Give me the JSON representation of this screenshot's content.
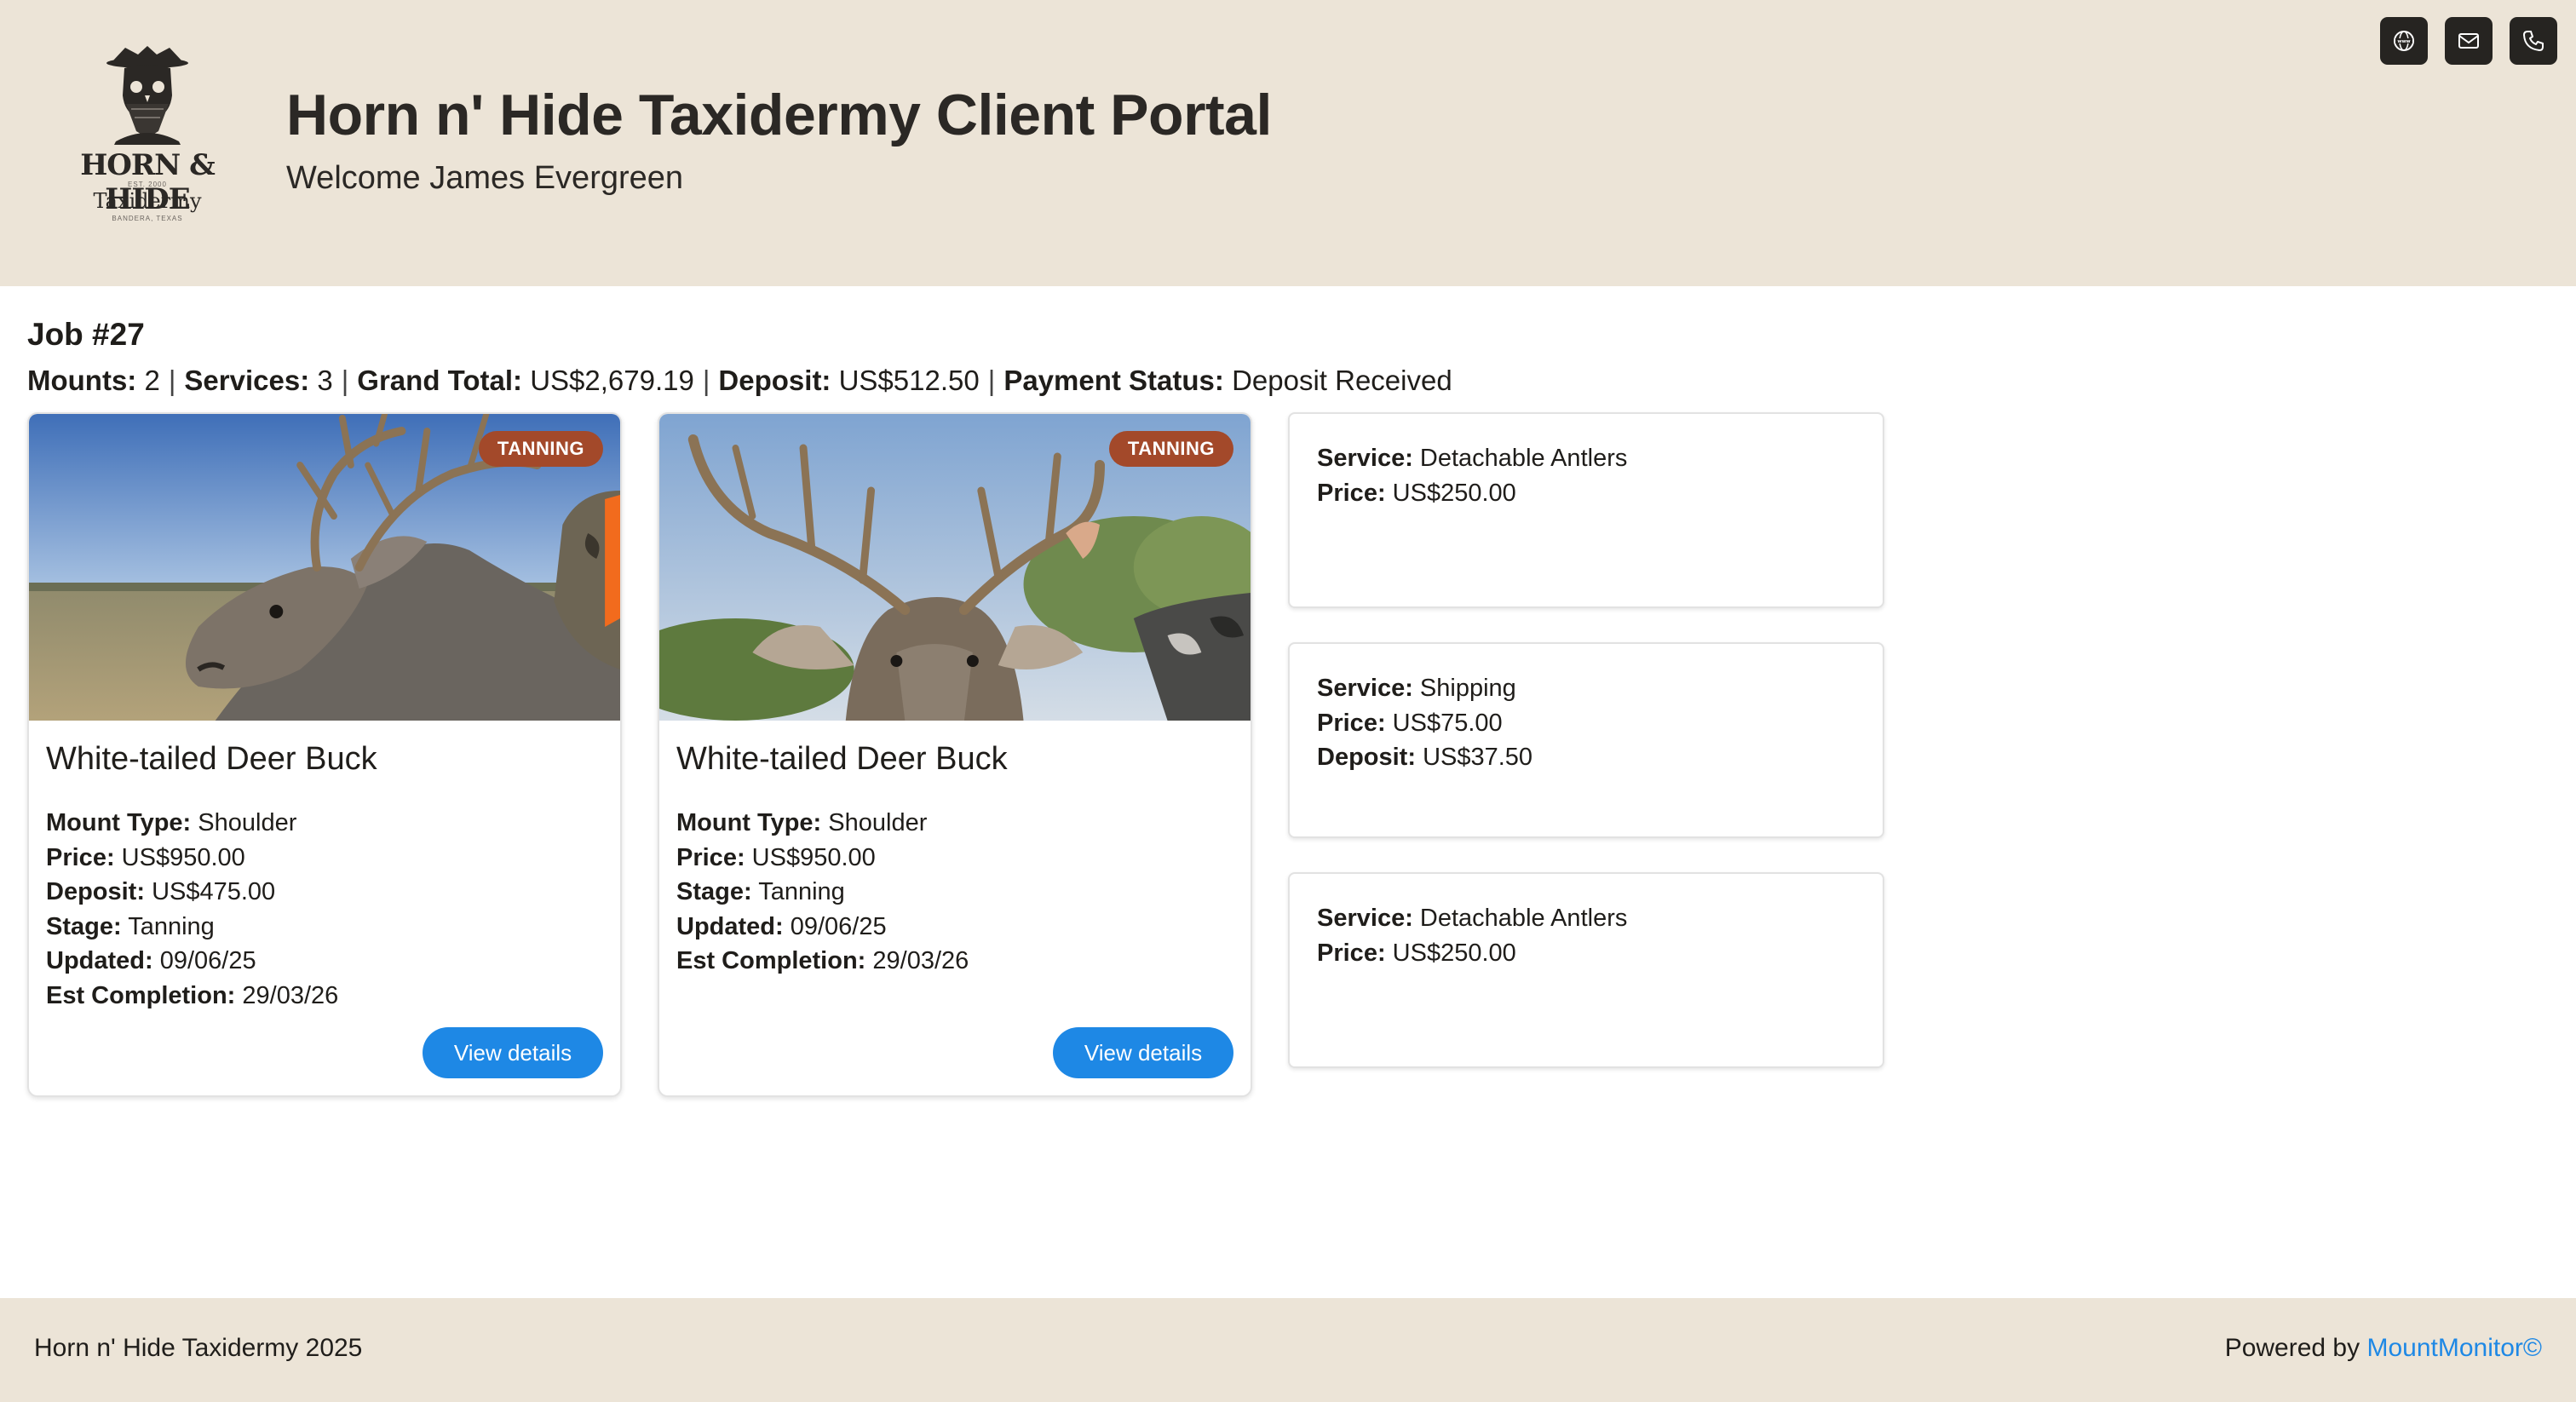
{
  "header": {
    "title": "Horn n' Hide Taxidermy Client Portal",
    "welcome": "Welcome James Evergreen",
    "logo": {
      "line1": "HORN & HIDE",
      "line2": "Taxidermy",
      "est": "EST. 2000",
      "location": "BANDERA, TEXAS"
    },
    "icons": [
      "www-icon",
      "mail-icon",
      "phone-icon"
    ]
  },
  "job": {
    "title": "Job #27",
    "mounts_label": "Mounts:",
    "mounts": "2",
    "services_label": "Services:",
    "services": "3",
    "grand_total_label": "Grand Total:",
    "grand_total": "US$2,679.19",
    "deposit_label": "Deposit:",
    "deposit": "US$512.50",
    "payment_status_label": "Payment Status:",
    "payment_status": "Deposit Received"
  },
  "mounts": [
    {
      "badge": "TANNING",
      "name": "White-tailed Deer Buck",
      "mount_type_label": "Mount Type:",
      "mount_type": "Shoulder",
      "price_label": "Price:",
      "price": "US$950.00",
      "deposit_label": "Deposit:",
      "deposit": "US$475.00",
      "stage_label": "Stage:",
      "stage": "Tanning",
      "updated_label": "Updated:",
      "updated": "09/06/25",
      "est_label": "Est Completion:",
      "est": "29/03/26",
      "button": "View details"
    },
    {
      "badge": "TANNING",
      "name": "White-tailed Deer Buck",
      "mount_type_label": "Mount Type:",
      "mount_type": "Shoulder",
      "price_label": "Price:",
      "price": "US$950.00",
      "stage_label": "Stage:",
      "stage": "Tanning",
      "updated_label": "Updated:",
      "updated": "09/06/25",
      "est_label": "Est Completion:",
      "est": "29/03/26",
      "button": "View details"
    }
  ],
  "services": [
    {
      "service_label": "Service:",
      "service": "Detachable Antlers",
      "price_label": "Price:",
      "price": "US$250.00"
    },
    {
      "service_label": "Service:",
      "service": "Shipping",
      "price_label": "Price:",
      "price": "US$75.00",
      "deposit_label": "Deposit:",
      "deposit": "US$37.50"
    },
    {
      "service_label": "Service:",
      "service": "Detachable Antlers",
      "price_label": "Price:",
      "price": "US$250.00"
    }
  ],
  "footer": {
    "left": "Horn n' Hide Taxidermy 2025",
    "powered_by": "Powered by",
    "link": "MountMonitor©"
  },
  "colors": {
    "header_bg": "#ece4d7",
    "badge": "#a3492a",
    "button": "#1e88e5",
    "icon_button": "#262421"
  }
}
